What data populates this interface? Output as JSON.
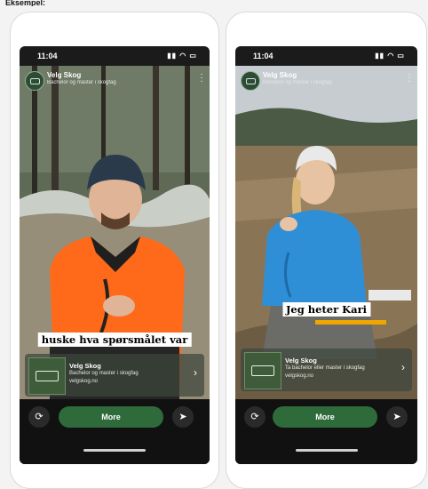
{
  "header_label": "Eksempel:",
  "phones": [
    {
      "time": "11:04",
      "status_icons": "signal, wifi, battery",
      "brand_name": "Velg Skog",
      "brand_subtitle": "Bachelor og master i skogfag",
      "caption": "huske hva spørsmålet var",
      "card_title": "Velg Skog",
      "card_line1": "Bachelor og master i skogfag",
      "card_line2": "velgskog.no",
      "more_label": "More"
    },
    {
      "time": "11:04",
      "status_icons": "signal, wifi, battery",
      "brand_name": "Velg Skog",
      "brand_subtitle": "Bachelor og master i skogfag",
      "caption": "Jeg heter Kari",
      "card_title": "Velg Skog",
      "card_line1": "Ta bachelor eller master i skogfag",
      "card_line2": "velgskog.no",
      "more_label": "More"
    }
  ],
  "colors": {
    "accent": "#2f6b3a",
    "bar": "#111111",
    "jacket_left": "#ff6a1a",
    "jacket_right": "#2f8fd6"
  }
}
